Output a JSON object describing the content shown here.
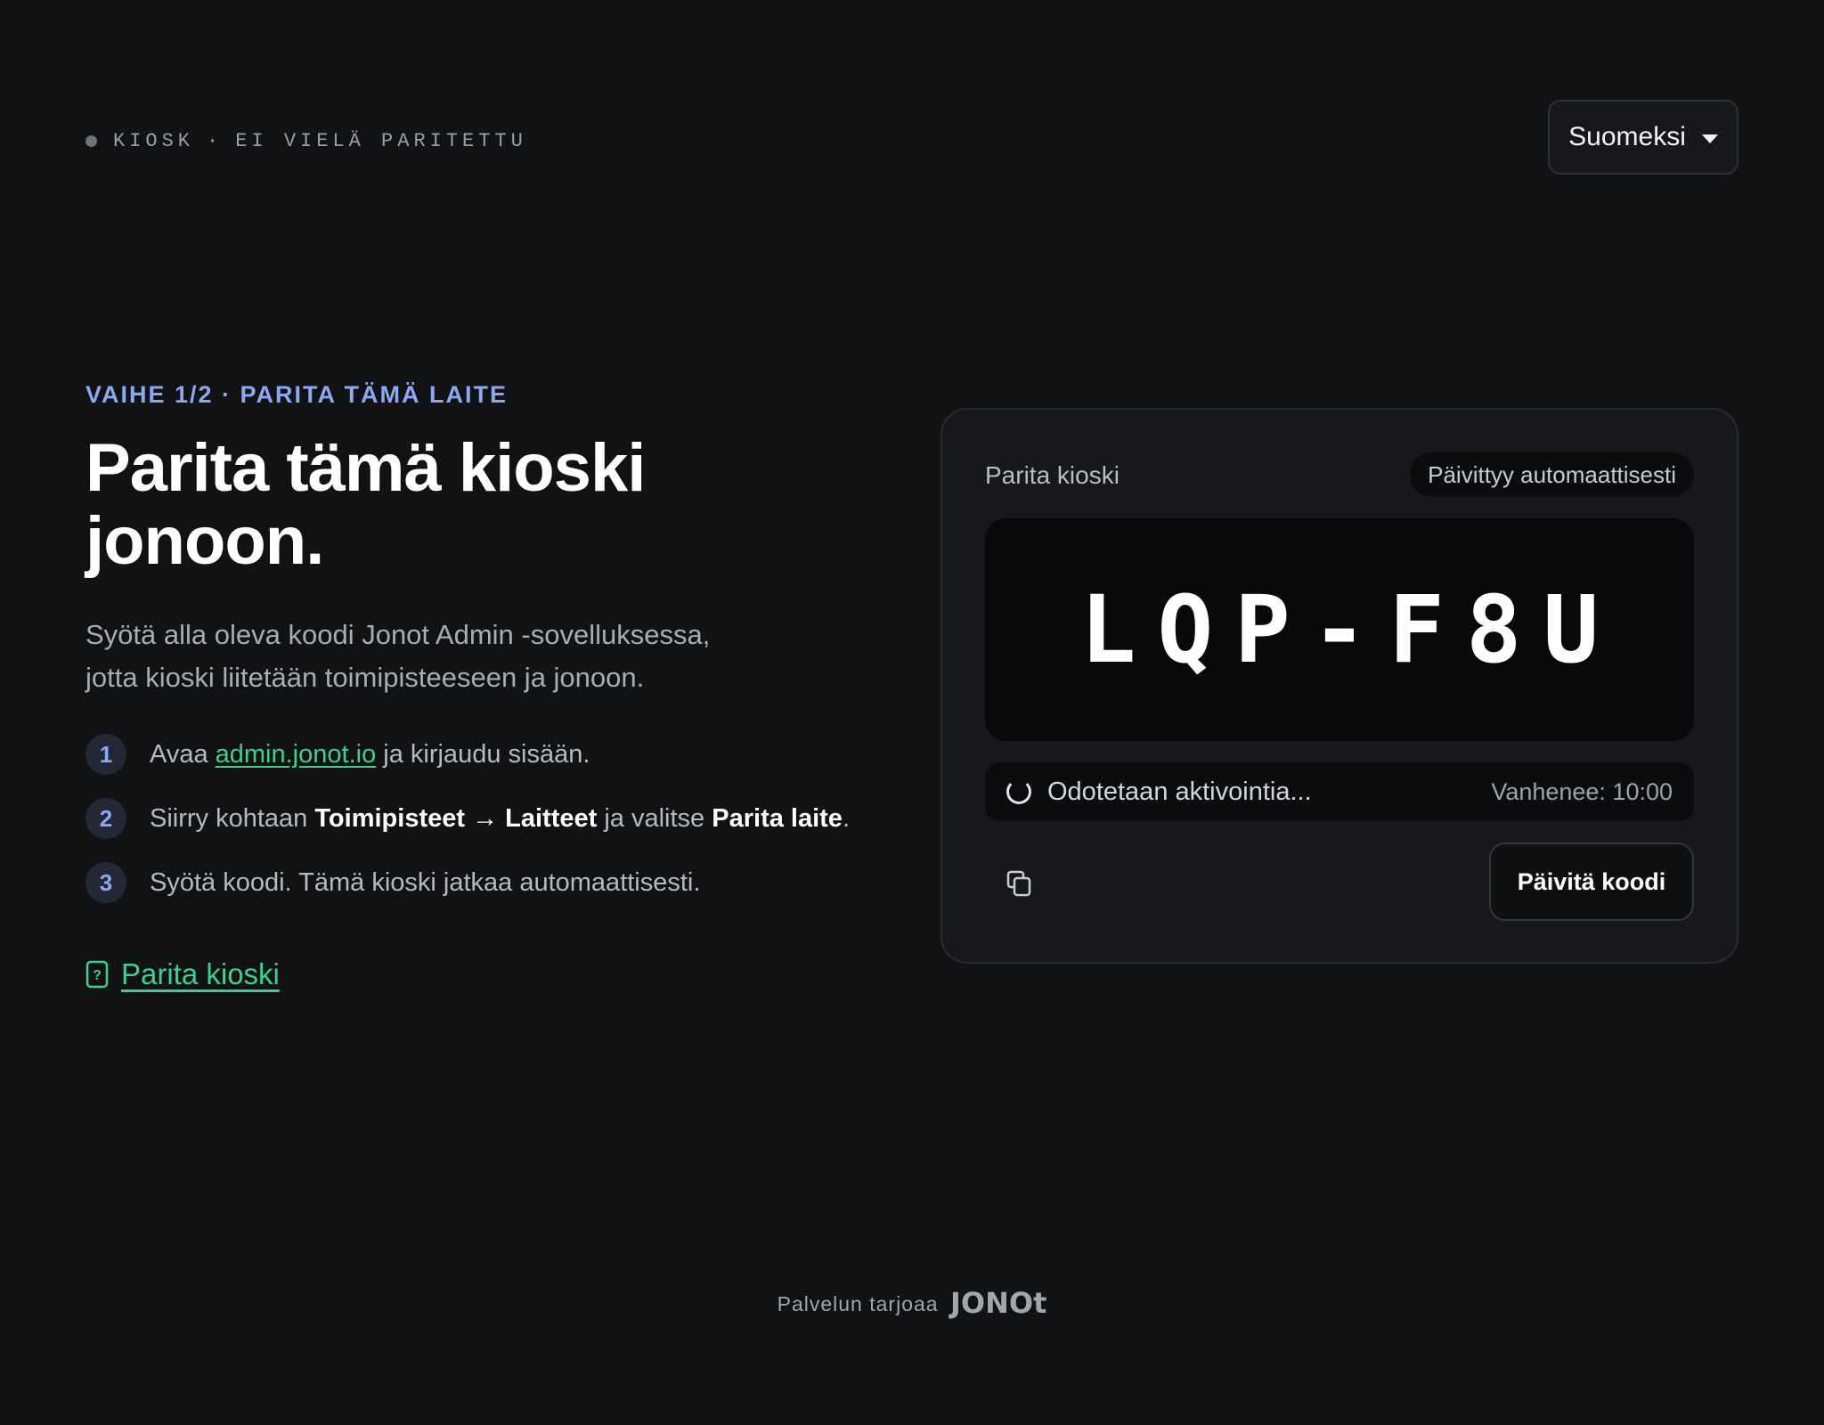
{
  "header": {
    "status": {
      "device": "KIOSK",
      "separator": "·",
      "state": "EI VIELÄ PARITETTU"
    },
    "language": {
      "selected": "Suomeksi"
    }
  },
  "intro": {
    "eyebrow": "VAIHE 1/2 · PARITA TÄMÄ LAITE",
    "title_line1": "Parita tämä kioski",
    "title_line2": "jonoon.",
    "description_line1": "Syötä alla oleva koodi Jonot Admin -sovelluksessa,",
    "description_line2": "jotta kioski liitetään toimipisteeseen ja jonoon."
  },
  "steps": [
    {
      "number": "1",
      "prefix": "Avaa",
      "link": "admin.jonot.io",
      "suffix": "ja kirjaudu sisään."
    },
    {
      "number": "2",
      "prefix": "Siirry kohtaan",
      "bold1": "Toimipisteet",
      "arrow": "→",
      "bold2": "Laitteet",
      "middle": "ja valitse",
      "bold3": "Parita laite",
      "end": "."
    },
    {
      "number": "3",
      "text": "Syötä koodi. Tämä kioski jatkaa automaattisesti."
    }
  ],
  "help": {
    "icon": "help-document-icon",
    "label": "Parita kioski"
  },
  "card": {
    "title": "Parita kioski",
    "badge": "Päivittyy automaattisesti",
    "code": "LQP-F8U",
    "status_text": "Odotetaan aktivointia...",
    "expires": "Vanhenee: 10:00",
    "copy_icon": "copy-icon",
    "refresh_label": "Päivitä koodi"
  },
  "footer": {
    "provided_by": "Palvelun tarjoaa",
    "logo": "JONOt"
  },
  "colors": {
    "background": "#111214",
    "accent_blue": "#8ea7f2",
    "accent_green": "#3ecf8e",
    "card": "#17181b"
  }
}
